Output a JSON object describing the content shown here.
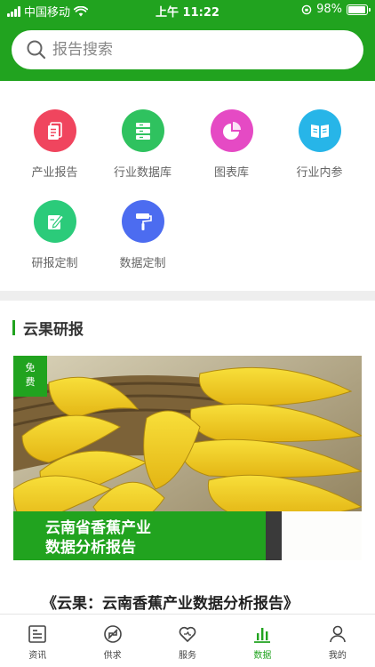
{
  "status_bar": {
    "carrier": "中国移动",
    "time": "上午 11:22",
    "battery_text": "98%",
    "battery_level": 0.98
  },
  "search": {
    "placeholder": "报告搜索"
  },
  "categories": [
    {
      "label": "产业报告",
      "icon": "report-icon",
      "color": "#f0455e"
    },
    {
      "label": "行业数据库",
      "icon": "database-icon",
      "color": "#2fc25f"
    },
    {
      "label": "图表库",
      "icon": "pie-chart-icon",
      "color": "#e54ac4"
    },
    {
      "label": "行业内参",
      "icon": "book-icon",
      "color": "#27b5e8"
    },
    {
      "label": "研报定制",
      "icon": "pencil-icon",
      "color": "#2bcb7a"
    },
    {
      "label": "数据定制",
      "icon": "paint-roller-icon",
      "color": "#4c6cf0"
    }
  ],
  "section": {
    "title": "云果研报"
  },
  "card": {
    "badge_line1": "免",
    "badge_line2": "费",
    "banner_line1": "云南省香蕉产业",
    "banner_line2": "数据分析报告",
    "title": "《云果：云南香蕉产业数据分析报告》"
  },
  "tabs": [
    {
      "label": "资讯",
      "icon": "news-icon",
      "active": false
    },
    {
      "label": "供求",
      "icon": "supply-demand-icon",
      "active": false
    },
    {
      "label": "服务",
      "icon": "heart-icon",
      "active": false
    },
    {
      "label": "数据",
      "icon": "bar-chart-icon",
      "active": true
    },
    {
      "label": "我的",
      "icon": "user-icon",
      "active": false
    }
  ],
  "colors": {
    "brand_green": "#21a31f",
    "divider": "#eeeeee"
  }
}
